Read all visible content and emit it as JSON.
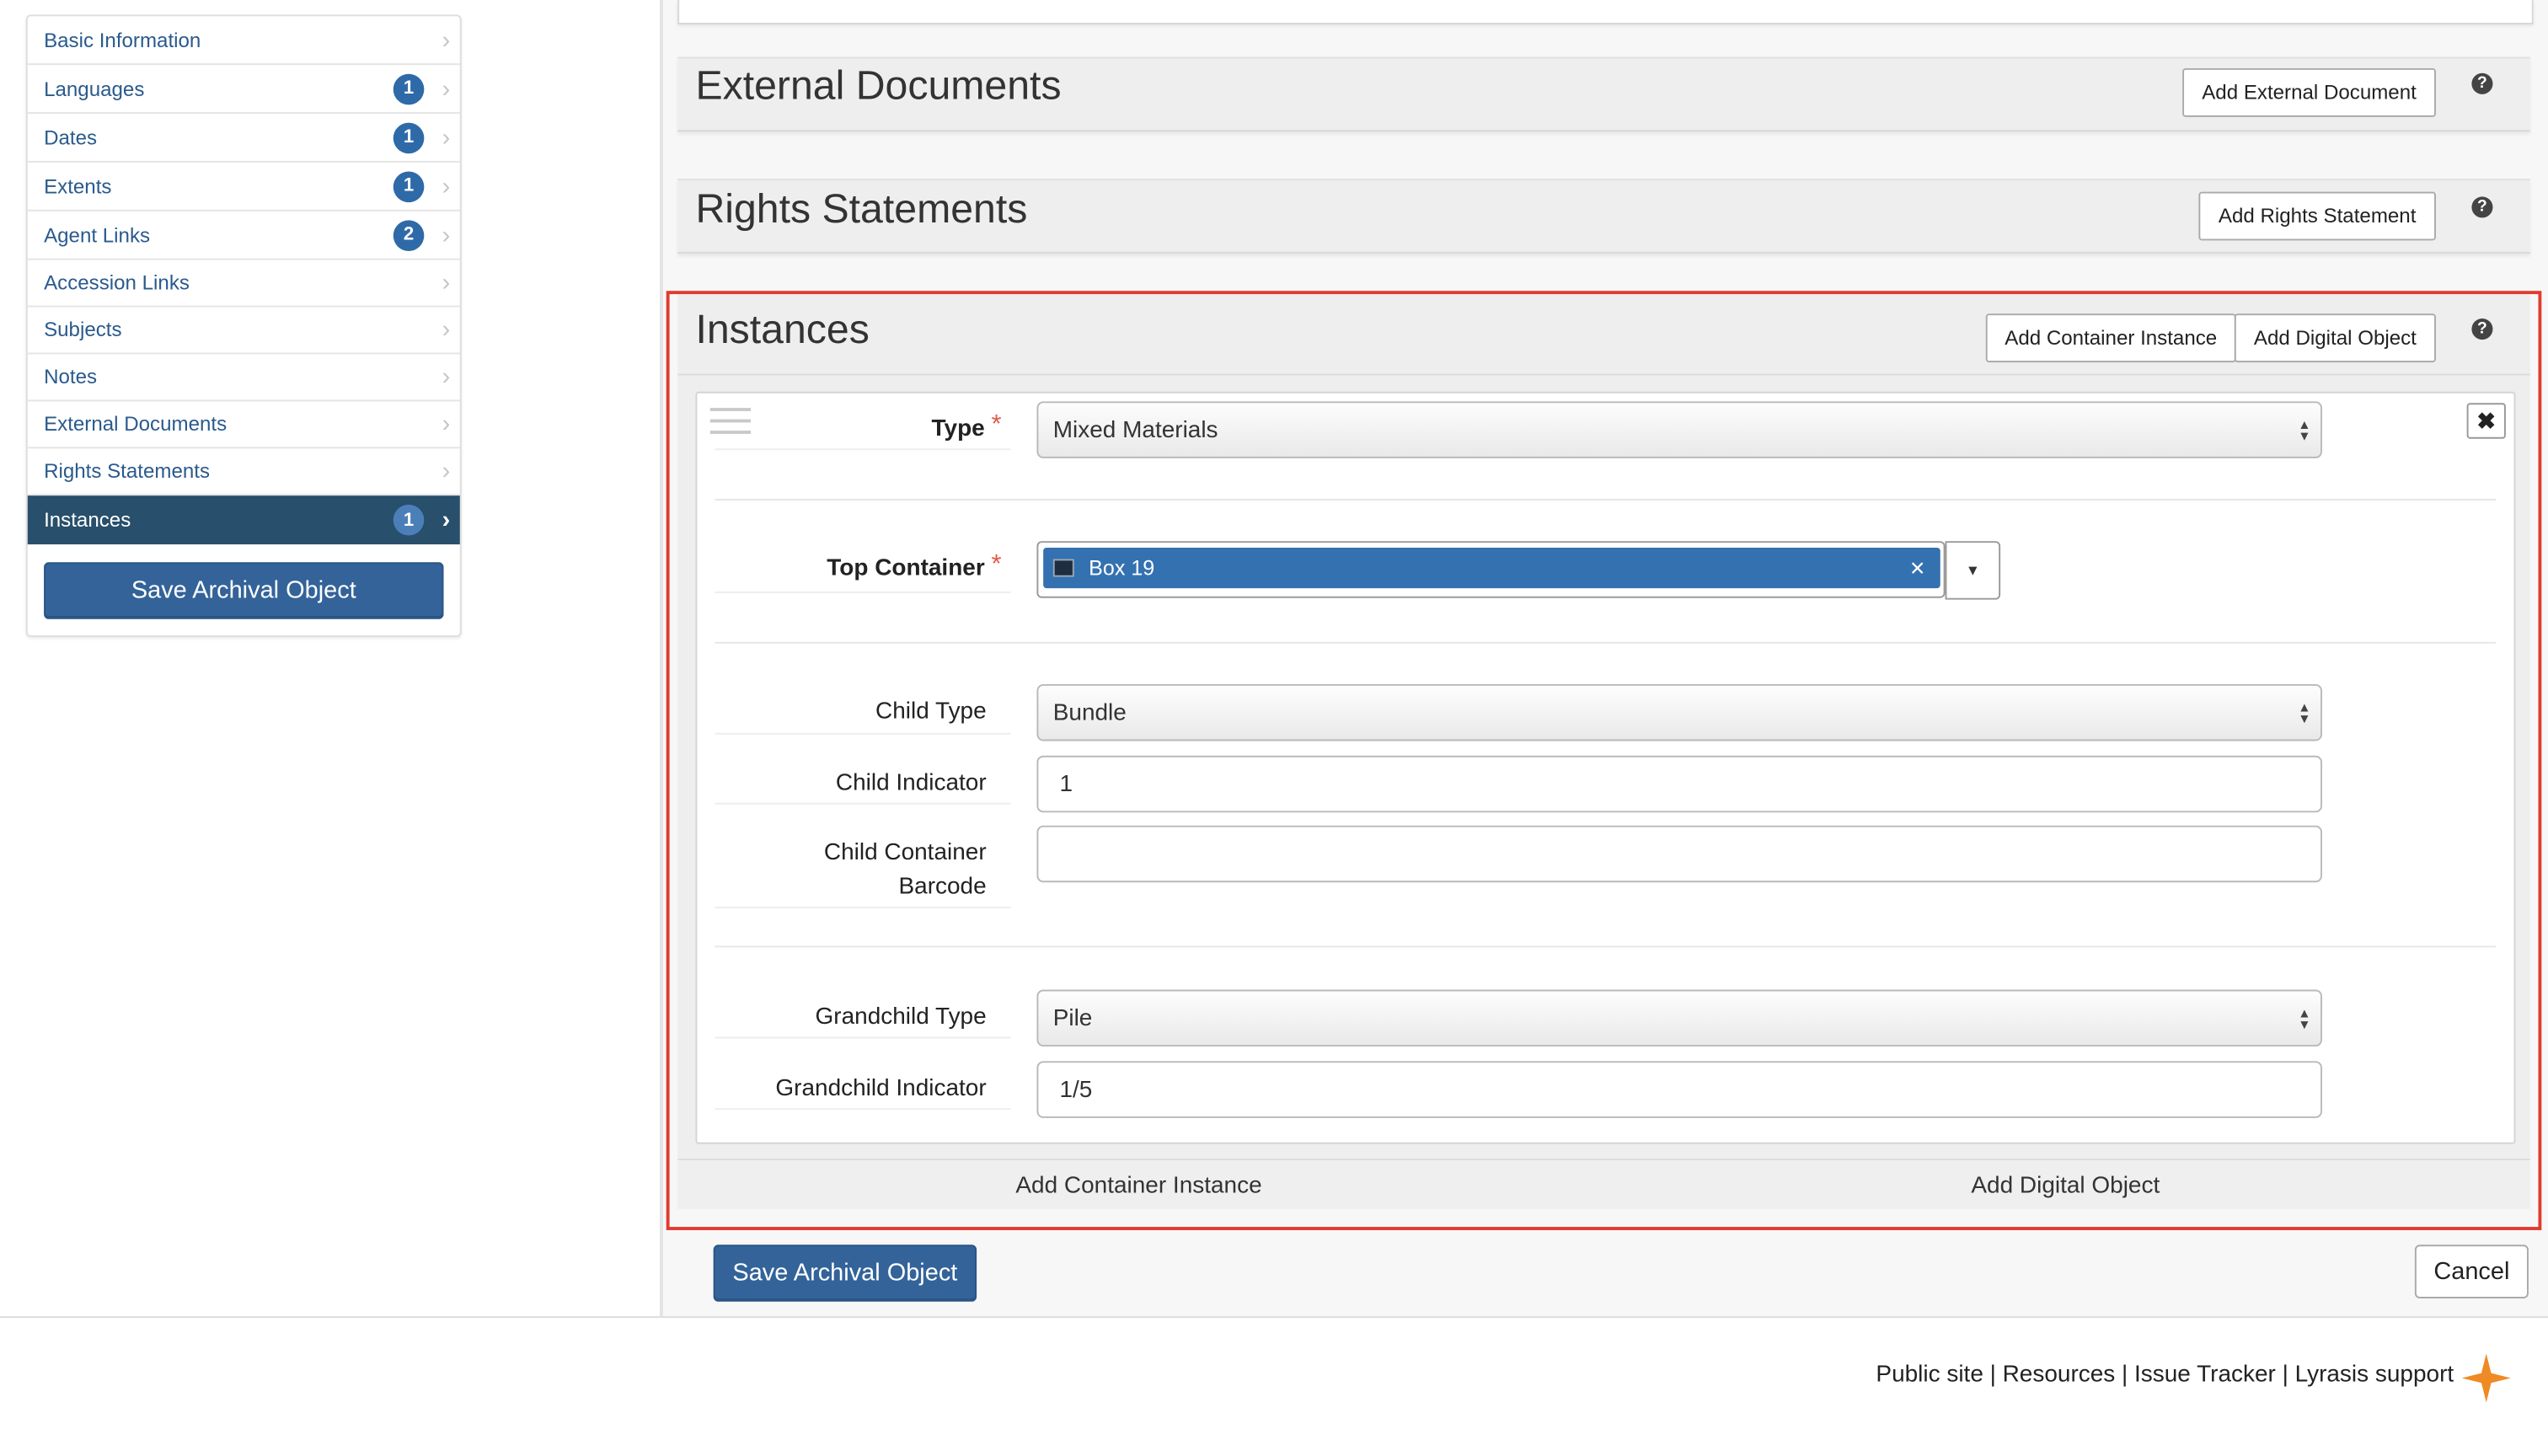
{
  "sidebar": {
    "items": [
      {
        "label": "Basic Information",
        "badge": ""
      },
      {
        "label": "Languages",
        "badge": "1"
      },
      {
        "label": "Dates",
        "badge": "1"
      },
      {
        "label": "Extents",
        "badge": "1"
      },
      {
        "label": "Agent Links",
        "badge": "2"
      },
      {
        "label": "Accession Links",
        "badge": ""
      },
      {
        "label": "Subjects",
        "badge": ""
      },
      {
        "label": "Notes",
        "badge": ""
      },
      {
        "label": "External Documents",
        "badge": ""
      },
      {
        "label": "Rights Statements",
        "badge": ""
      },
      {
        "label": "Instances",
        "badge": "1",
        "active": true
      }
    ],
    "save_label": "Save Archival Object"
  },
  "sections": {
    "external_documents": {
      "title": "External Documents",
      "add_label": "Add External Document"
    },
    "rights_statements": {
      "title": "Rights Statements",
      "add_label": "Add Rights Statement"
    },
    "instances": {
      "title": "Instances",
      "add_container_label": "Add Container Instance",
      "add_digital_label": "Add Digital Object",
      "help_glyph": "?",
      "form": {
        "type_label": "Type",
        "type_value": "Mixed Materials",
        "top_container_label": "Top Container",
        "top_container_value": "Box 19",
        "child_type_label": "Child Type",
        "child_type_value": "Bundle",
        "child_indicator_label": "Child Indicator",
        "child_indicator_value": "1",
        "child_barcode_label_1": "Child Container",
        "child_barcode_label_2": "Barcode",
        "child_barcode_value": "",
        "grandchild_type_label": "Grandchild Type",
        "grandchild_type_value": "Pile",
        "grandchild_indicator_label": "Grandchild Indicator",
        "grandchild_indicator_value": "1/5",
        "required_mark": "*"
      },
      "bottom_add_container": "Add Container Instance",
      "bottom_add_digital": "Add Digital Object"
    }
  },
  "actions": {
    "save_label": "Save Archival Object",
    "cancel_label": "Cancel"
  },
  "footer": {
    "links": [
      "Public site",
      "Resources",
      "Issue Tracker",
      "Lyrasis support"
    ],
    "separator": "|"
  },
  "colors": {
    "primary": "#336399",
    "active_nav": "#284f6b",
    "highlight": "#e23b2e",
    "badge": "#2f6aa8",
    "star": "#f08a24"
  }
}
